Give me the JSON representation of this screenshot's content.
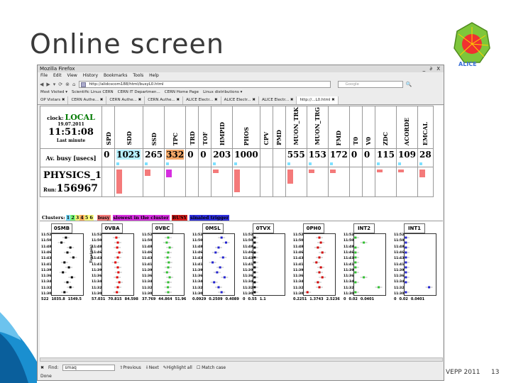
{
  "slide": {
    "title": "Online screen",
    "footer_left": "VEPP 2011",
    "page_number": "13",
    "logo_text": "ALICE"
  },
  "browser": {
    "window_title": "Mozilla Firefox",
    "window_controls": "_ ∂ X",
    "menu": [
      "File",
      "Edit",
      "View",
      "History",
      "Bookmarks",
      "Tools",
      "Help"
    ],
    "url": "http://alidcscom188/html/busyL0.html",
    "search_placeholder": "Google",
    "bookmarks": [
      "Most Visited ▾",
      "Scientific Linux CERN",
      "CERN IT Departmen...",
      "CERN Home Page",
      "Linux distributions ▾"
    ],
    "tabs": [
      {
        "label": "OP Vistars",
        "active": false
      },
      {
        "label": "CERN Authe...",
        "active": false
      },
      {
        "label": "CERN Authe...",
        "active": false
      },
      {
        "label": "CERN Authe...",
        "active": false
      },
      {
        "label": "ALICE Electr...",
        "active": false
      },
      {
        "label": "ALICE Electr...",
        "active": false
      },
      {
        "label": "ALICE Electr...",
        "active": false
      },
      {
        "label": "http://...L0.html",
        "active": true
      }
    ],
    "find_label": "Find:",
    "find_value": "smaq",
    "find_previous": "Previous",
    "find_next": "Next",
    "highlight_all": "Highlight all",
    "match_case": "Match case",
    "status": "Done"
  },
  "monitor": {
    "clock_label": "clock:",
    "clock_mode": "LOCAL",
    "date": "19.07.2011",
    "time": "11:51:08",
    "last_minute": "Last minute",
    "busy_label": "Av. busy [usecs]",
    "run_type": "PHYSICS_1",
    "run_label": "Run:",
    "run_number": "156967",
    "detectors": [
      {
        "name": "SPD",
        "busy": "0",
        "busy_bg": "#ffffff",
        "ev_color": "",
        "ev_level": 0
      },
      {
        "name": "SDD",
        "busy": "1023",
        "busy_bg": "#b8f0ff",
        "ev_color": "#f47a7a",
        "ev_level": 0.95
      },
      {
        "name": "SSD",
        "busy": "265",
        "busy_bg": "#ffffff",
        "ev_color": "#f47a7a",
        "ev_level": 0.25
      },
      {
        "name": "TPC",
        "busy": "332",
        "busy_bg": "#f4a868",
        "ev_color": "#d62ee0",
        "ev_level": 0.3
      },
      {
        "name": "TRD",
        "busy": "0",
        "busy_bg": "#ffffff",
        "ev_color": "",
        "ev_level": 0
      },
      {
        "name": "TOF",
        "busy": "0",
        "busy_bg": "#ffffff",
        "ev_color": "",
        "ev_level": 0
      },
      {
        "name": "HMPID",
        "busy": "203",
        "busy_bg": "#ffffff",
        "ev_color": "#f47a7a",
        "ev_level": 0.15
      },
      {
        "name": "PHOS",
        "busy": "1000",
        "busy_bg": "#ffffff",
        "ev_color": "#f47a7a",
        "ev_level": 0.9
      },
      {
        "name": "CPV",
        "busy": "",
        "busy_bg": "#ffffff",
        "ev_color": "",
        "ev_level": 0
      },
      {
        "name": "PMD",
        "busy": "",
        "busy_bg": "#ffffff",
        "ev_color": "",
        "ev_level": 0
      },
      {
        "name": "MUON_TRK",
        "busy": "555",
        "busy_bg": "#ffffff",
        "ev_color": "#f47a7a",
        "ev_level": 0.55
      },
      {
        "name": "MUON_TRG",
        "busy": "153",
        "busy_bg": "#ffffff",
        "ev_color": "#f47a7a",
        "ev_level": 0.15
      },
      {
        "name": "FMD",
        "busy": "172",
        "busy_bg": "#ffffff",
        "ev_color": "#f47a7a",
        "ev_level": 0.15
      },
      {
        "name": "T0",
        "busy": "0",
        "busy_bg": "#ffffff",
        "ev_color": "",
        "ev_level": 0
      },
      {
        "name": "V0",
        "busy": "0",
        "busy_bg": "#ffffff",
        "ev_color": "",
        "ev_level": 0
      },
      {
        "name": "ZDC",
        "busy": "115",
        "busy_bg": "#ffffff",
        "ev_color": "#f47a7a",
        "ev_level": 0.1
      },
      {
        "name": "ACORDE",
        "busy": "109",
        "busy_bg": "#ffffff",
        "ev_color": "#f47a7a",
        "ev_level": 0.1
      },
      {
        "name": "EMCAL",
        "busy": "28",
        "busy_bg": "#ffffff",
        "ev_color": "#f47a7a",
        "ev_level": 0.3
      }
    ],
    "clusters_label": "Clusters:",
    "clusters": [
      {
        "n": "1",
        "color": "#7de0ff"
      },
      {
        "n": "2",
        "color": "#7fff7f"
      },
      {
        "n": "3",
        "color": "#ffff7f"
      },
      {
        "n": "4",
        "color": "#ffb060"
      },
      {
        "n": "5",
        "color": "#ffff7f"
      },
      {
        "n": "6",
        "color": "#ffff7f"
      }
    ],
    "legend": [
      {
        "text": "busy",
        "bg": "#f47a7a",
        "fg": "#000000"
      },
      {
        "text": "slowest in the cluster",
        "bg": "#d62ee0",
        "fg": "#000000"
      },
      {
        "text": "BUSY",
        "bg": "#e02020",
        "fg": "#000000"
      },
      {
        "text": "sinaled trigger",
        "bg": "#3030e0",
        "fg": "#000000"
      }
    ],
    "time_axis": "Time(min)",
    "y_ticks": [
      "11:52",
      "11:50",
      "11:48",
      "11:46",
      "11:43",
      "11:41",
      "11:39",
      "11:36",
      "11:34",
      "11:32",
      "11:30"
    ],
    "plots": [
      {
        "title": "0SMB",
        "color": "#000000",
        "x_ticks": [
          "522",
          "1035.8",
          "1549.5"
        ],
        "values": [
          0.45,
          0.3,
          0.6,
          0.5,
          0.7,
          0.4,
          0.55,
          0.35,
          0.65,
          0.5,
          0.6,
          0.4
        ]
      },
      {
        "title": "0VBA",
        "color": "#e00000",
        "x_ticks": [
          "57.031",
          "70.815",
          "84.598"
        ],
        "values": [
          0.45,
          0.5,
          0.48,
          0.55,
          0.5,
          0.42,
          0.5,
          0.52,
          0.48,
          0.55,
          0.5,
          0.47
        ]
      },
      {
        "title": "0VBC",
        "color": "#30c030",
        "x_ticks": [
          "37.769",
          "44.864",
          "51.96"
        ],
        "values": [
          0.5,
          0.45,
          0.55,
          0.5,
          0.48,
          0.52,
          0.5,
          0.46,
          0.55,
          0.5,
          0.49,
          0.5
        ]
      },
      {
        "title": "0MSL",
        "color": "#2020d0",
        "x_ticks": [
          "0.0929",
          "0.2509",
          "0.4089"
        ],
        "values": [
          0.6,
          0.75,
          0.5,
          0.4,
          0.65,
          0.3,
          0.55,
          0.45,
          0.7,
          0.35,
          0.5,
          0.6
        ]
      },
      {
        "title": "0TVX",
        "color": "#000000",
        "x_ticks": [
          "0",
          "0.55",
          "1.1"
        ],
        "values": [
          0.02,
          0.02,
          0.02,
          0.02,
          0.02,
          0.02,
          0.02,
          0.02,
          0.02,
          0.02,
          0.02,
          0.02
        ]
      },
      {
        "title": "0PH0",
        "color": "#d00000",
        "x_ticks": [
          "0.2251",
          "1.3743",
          "2.5236"
        ],
        "values": [
          0.5,
          0.55,
          0.45,
          0.6,
          0.5,
          0.4,
          0.55,
          0.5,
          0.6,
          0.45,
          0.5,
          0.1
        ]
      },
      {
        "title": "INT2",
        "color": "#30c030",
        "x_ticks": [
          "0",
          "0.02",
          "0.0401"
        ],
        "values": [
          0.02,
          0.3,
          0.02,
          0.02,
          0.02,
          0.02,
          0.02,
          0.02,
          0.3,
          0.02,
          0.8,
          0.02
        ]
      },
      {
        "title": "INT1",
        "color": "#2020d0",
        "x_ticks": [
          "0",
          "0.02",
          "0.0401"
        ],
        "values": [
          0.02,
          0.02,
          0.02,
          0.02,
          0.02,
          0.02,
          0.02,
          0.02,
          0.02,
          0.02,
          0.8,
          0.02
        ]
      }
    ]
  }
}
